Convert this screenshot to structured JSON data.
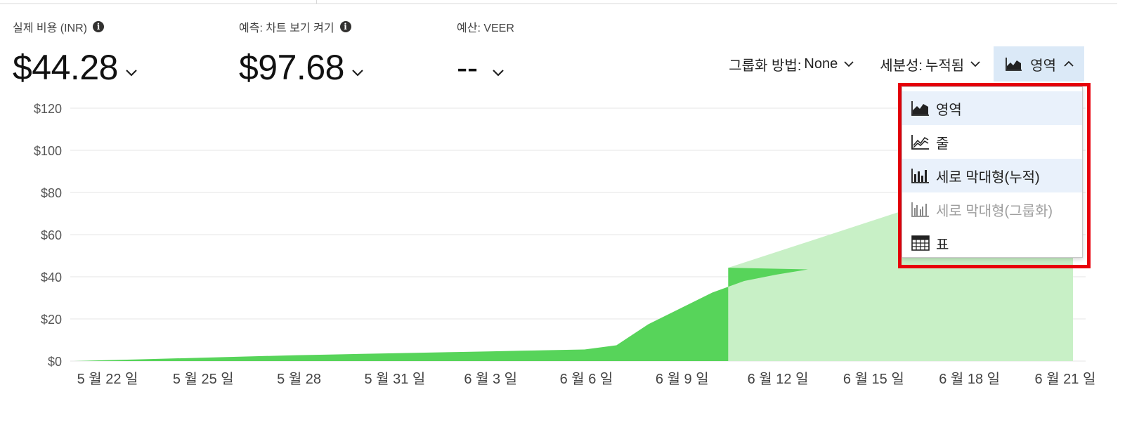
{
  "metrics": [
    {
      "label": "실제 비용 (INR)",
      "value": "$44.28",
      "has_info": true
    },
    {
      "label": "예측: 차트 보기 켜기",
      "value": "$97.68",
      "has_info": true
    },
    {
      "label": "예산: VEER",
      "value": "--",
      "has_info": false
    }
  ],
  "toolbar": {
    "group_by_label": "그룹화 방법:",
    "group_by_value": "None",
    "granularity_label": "세분성:",
    "granularity_value": "누적됨",
    "chart_type_label": "영역"
  },
  "menu": {
    "items": [
      {
        "label": "영역",
        "icon": "area-chart-icon",
        "state": "selected"
      },
      {
        "label": "줄",
        "icon": "line-chart-icon",
        "state": "normal"
      },
      {
        "label": "세로 막대형(누적)",
        "icon": "column-chart-icon",
        "state": "hover"
      },
      {
        "label": "세로 막대형(그룹화)",
        "icon": "column-chart-icon",
        "state": "disabled"
      },
      {
        "label": "표",
        "icon": "table-icon",
        "state": "normal"
      }
    ]
  },
  "colors": {
    "actual": "#57d45a",
    "forecast": "#c8f0c6",
    "highlight": "#e8000b",
    "active_bg": "#dbe9f7"
  },
  "chart_data": {
    "type": "area",
    "y_ticks": [
      "$0",
      "$20",
      "$40",
      "$60",
      "$80",
      "$100",
      "$120"
    ],
    "ylim": [
      0,
      120
    ],
    "x_ticks": [
      "5 월 22 일",
      "5 월 25 일",
      "5 월 28",
      "5 월 31 일",
      "6 월 3 일",
      "6 월 6 일",
      "6 월 9 일",
      "6 월 12 일",
      "6 월 15 일",
      "6 월 18 일",
      "6 월 21 일"
    ],
    "x_tick_days": [
      0,
      3,
      6,
      9,
      12,
      15,
      18,
      21,
      24,
      27,
      30
    ],
    "actual_day_values": [
      0.0,
      0.4,
      0.8,
      1.2,
      1.6,
      2.0,
      2.4,
      2.8,
      3.1,
      3.4,
      3.7,
      4.0,
      4.3,
      4.6,
      4.9,
      5.2,
      5.5,
      7.5,
      17.5,
      25.0,
      32.5,
      38.0,
      41.0,
      43.5,
      44.28
    ],
    "actual_end_day": 20.5,
    "forecast_end_day": 31.3,
    "forecast_end_value": 97.68
  }
}
